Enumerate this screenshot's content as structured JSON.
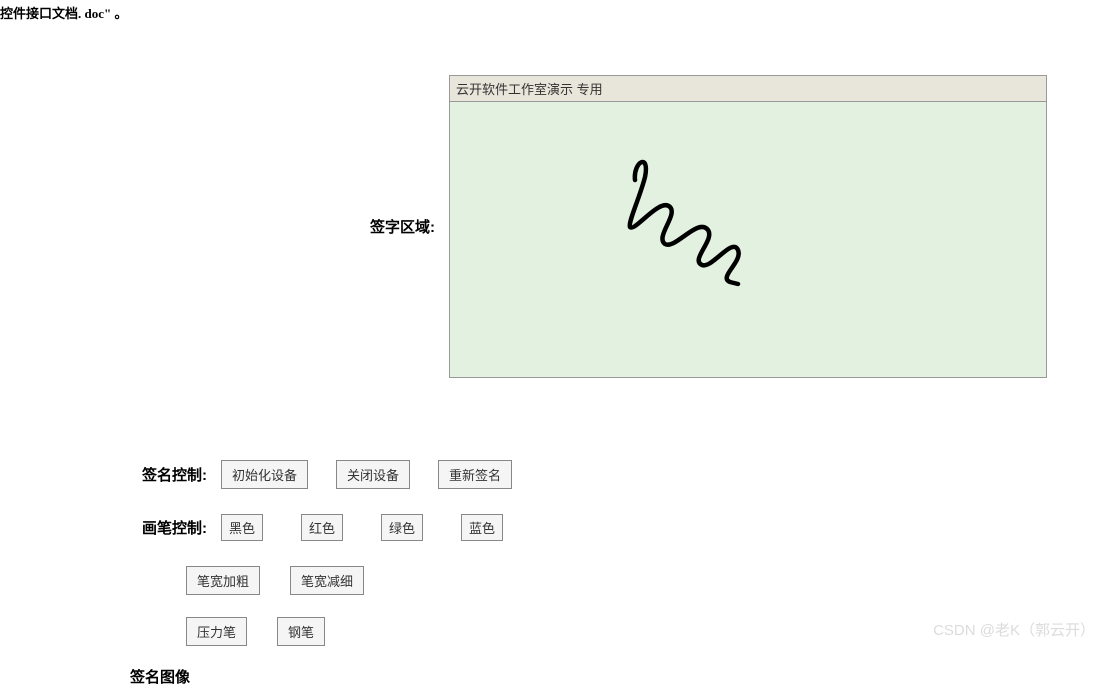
{
  "header": {
    "fragment_text": "控件接口文档. doc\" 。"
  },
  "signature_area": {
    "label": "签字区域:",
    "panel_title": "云开软件工作室演示  专用"
  },
  "sign_control": {
    "label": "签名控制:",
    "buttons": {
      "init": "初始化设备",
      "close": "关闭设备",
      "resign": "重新签名"
    }
  },
  "pen_control": {
    "label": "画笔控制:",
    "colors": {
      "black": "黑色",
      "red": "红色",
      "green": "绿色",
      "blue": "蓝色"
    },
    "width": {
      "thicker": "笔宽加粗",
      "thinner": "笔宽减细"
    },
    "type": {
      "pressure": "压力笔",
      "pen": "钢笔"
    }
  },
  "image_control": {
    "label_partial": "签名图像"
  },
  "watermark": "CSDN @老K（郭云开）"
}
